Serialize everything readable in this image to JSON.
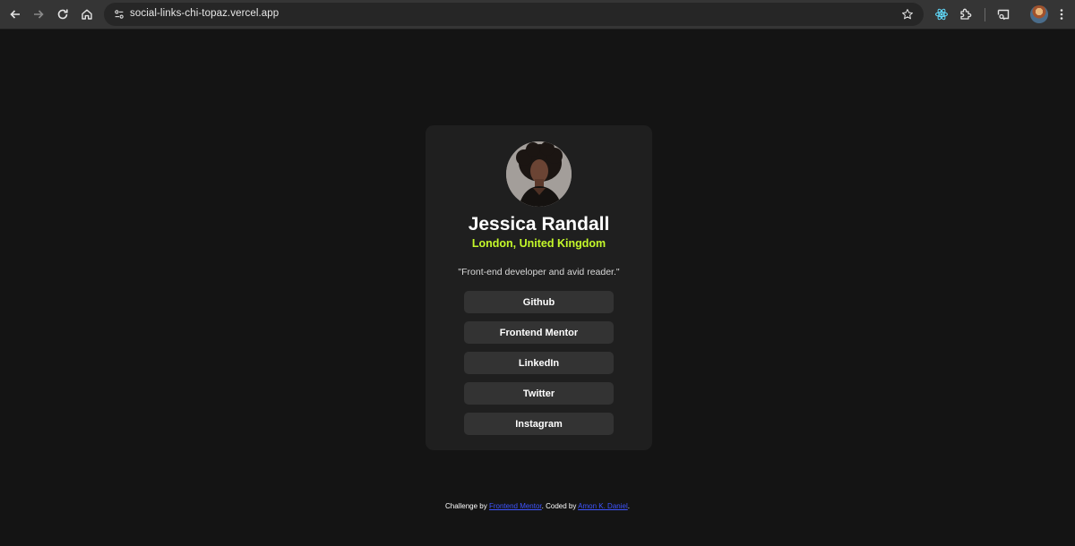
{
  "browser": {
    "url": "social-links-chi-topaz.vercel.app",
    "icons": {
      "back": "arrow-left-icon",
      "forward": "arrow-right-icon",
      "reload": "reload-icon",
      "home": "home-icon",
      "site_info": "tune-icon",
      "bookmark": "star-icon",
      "extension_react": "react-icon",
      "extensions": "puzzle-icon",
      "search_tabs": "tab-search-icon",
      "menu": "kebab-menu-icon"
    }
  },
  "profile": {
    "name": "Jessica Randall",
    "location": "London, United Kingdom",
    "bio": "\"Front-end developer and avid reader.\""
  },
  "links": [
    {
      "label": "Github"
    },
    {
      "label": "Frontend Mentor"
    },
    {
      "label": "LinkedIn"
    },
    {
      "label": "Twitter"
    },
    {
      "label": "Instagram"
    }
  ],
  "footer": {
    "prefix": "Challenge by ",
    "challenge_link": "Frontend Mentor",
    "middle": ". Coded by ",
    "author_link": "Amon K. Daniel",
    "suffix": "."
  },
  "colors": {
    "page_bg": "#141414",
    "card_bg": "#1f1f1f",
    "button_bg": "#333333",
    "accent_green": "#c4f82a",
    "link_blue": "#3e54ff"
  }
}
